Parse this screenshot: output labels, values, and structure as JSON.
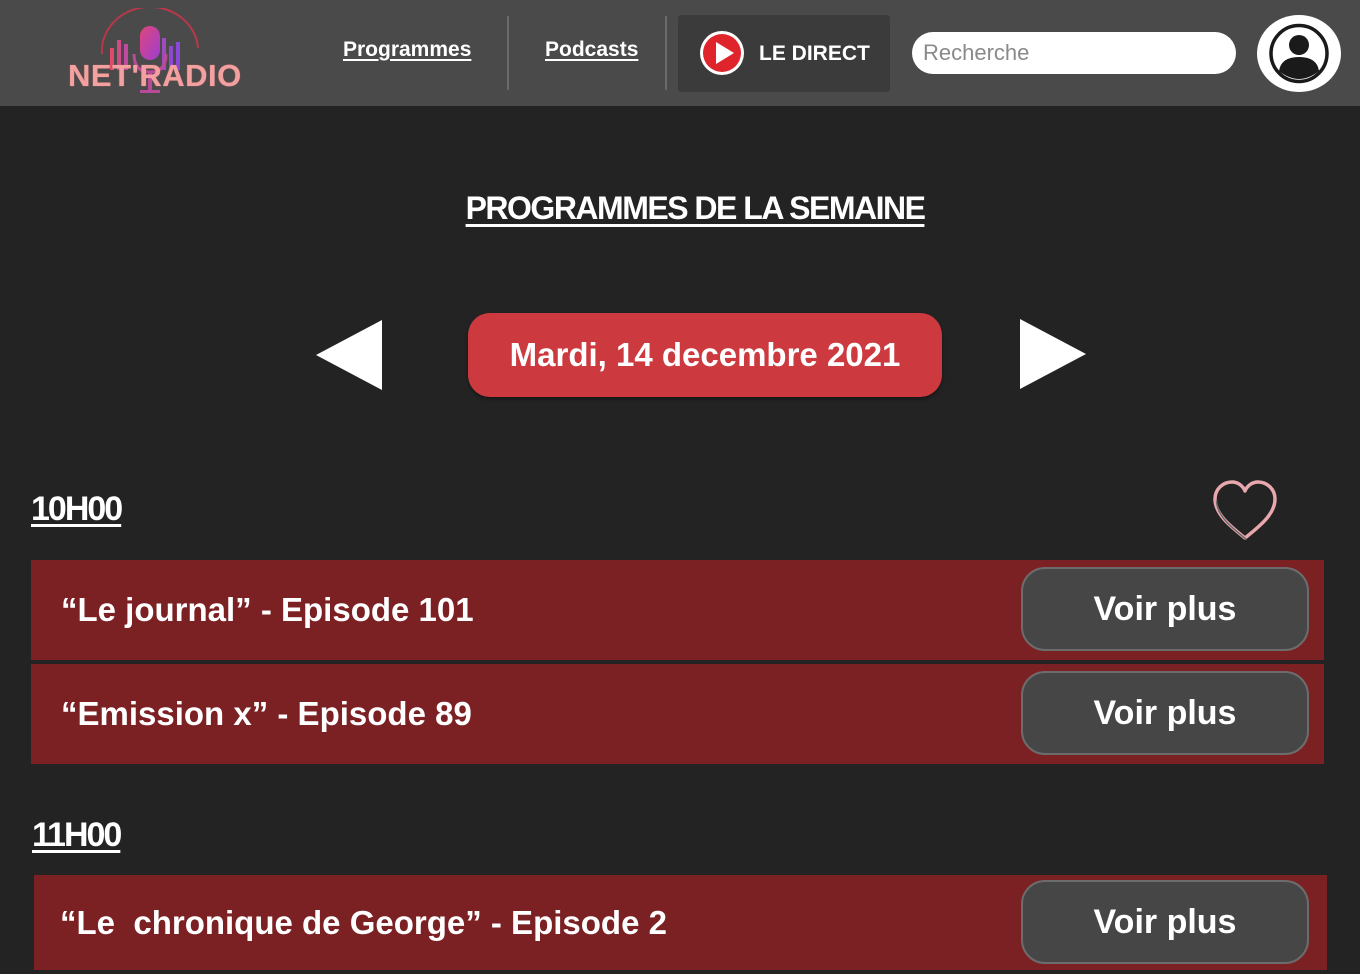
{
  "header": {
    "logo_text": "NET'RADIO",
    "nav": {
      "programmes": "Programmes",
      "podcasts": "Podcasts"
    },
    "live_label": "LE DIRECT",
    "search_placeholder": "Recherche"
  },
  "main": {
    "title": "PROGRAMMES DE LA SEMAINE",
    "date": "Mardi, 14 decembre 2021",
    "slots": [
      {
        "time": "10H00",
        "shows": [
          {
            "title": "“Le journal” - Episode 101",
            "button": "Voir plus"
          },
          {
            "title": "“Emission x” - Episode 89",
            "button": "Voir plus"
          }
        ]
      },
      {
        "time": "11H00",
        "shows": [
          {
            "title": "“Le  chronique de George” - Episode 2",
            "button": "Voir plus"
          }
        ]
      }
    ]
  },
  "colors": {
    "background": "#232323",
    "header": "#4a4a4a",
    "accent_red": "#cc3a3f",
    "row_red": "#7b2124",
    "button_gray": "#464646"
  },
  "icons": [
    "microphone-logo-icon",
    "play-icon",
    "user-icon",
    "arrow-left-icon",
    "arrow-right-icon",
    "heart-icon"
  ]
}
